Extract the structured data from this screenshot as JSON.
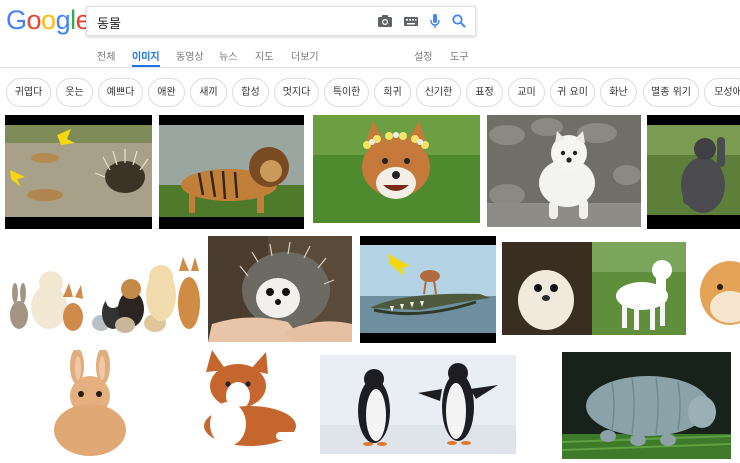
{
  "logo": {
    "letters": [
      "G",
      "o",
      "o",
      "g",
      "l",
      "e"
    ],
    "colors": [
      "#4285F4",
      "#EA4335",
      "#FBBC05",
      "#4285F4",
      "#34A853",
      "#EA4335"
    ]
  },
  "search": {
    "query": "동물"
  },
  "tabs": {
    "all": "전체",
    "images": "이미지",
    "videos": "동영상",
    "news": "뉴스",
    "maps": "지도",
    "more": "더보기",
    "settings": "설정",
    "tools": "도구"
  },
  "chips": [
    "귀엽다",
    "웃는",
    "예쁘다",
    "애완",
    "새끼",
    "합성",
    "멋지다",
    "특이한",
    "희귀",
    "신기한",
    "표정",
    "교미",
    "귀 요미",
    "화난",
    "멸종 위기",
    "모성애"
  ],
  "colors": {
    "accent": "#1a73e8",
    "chip_border": "#dcdcdc",
    "arrow": "#f5d80b"
  },
  "icons": {
    "camera": "camera-icon",
    "keyboard": "keyboard-icon",
    "mic": "mic-icon",
    "search": "search-icon"
  },
  "results": [
    {
      "subject": "porcupine-and-lions"
    },
    {
      "subject": "lion-tiger"
    },
    {
      "subject": "corgi-flower-crown"
    },
    {
      "subject": "white-puppy"
    },
    {
      "subject": "gorilla"
    },
    {
      "subject": "pets-group"
    },
    {
      "subject": "hedgehog-in-hands"
    },
    {
      "subject": "bird-on-crocodile"
    },
    {
      "subject": "seal-and-alpaca"
    },
    {
      "subject": "hamster"
    },
    {
      "subject": "rabbit"
    },
    {
      "subject": "corgi-puppy"
    },
    {
      "subject": "penguins"
    },
    {
      "subject": "tardigrade"
    }
  ]
}
